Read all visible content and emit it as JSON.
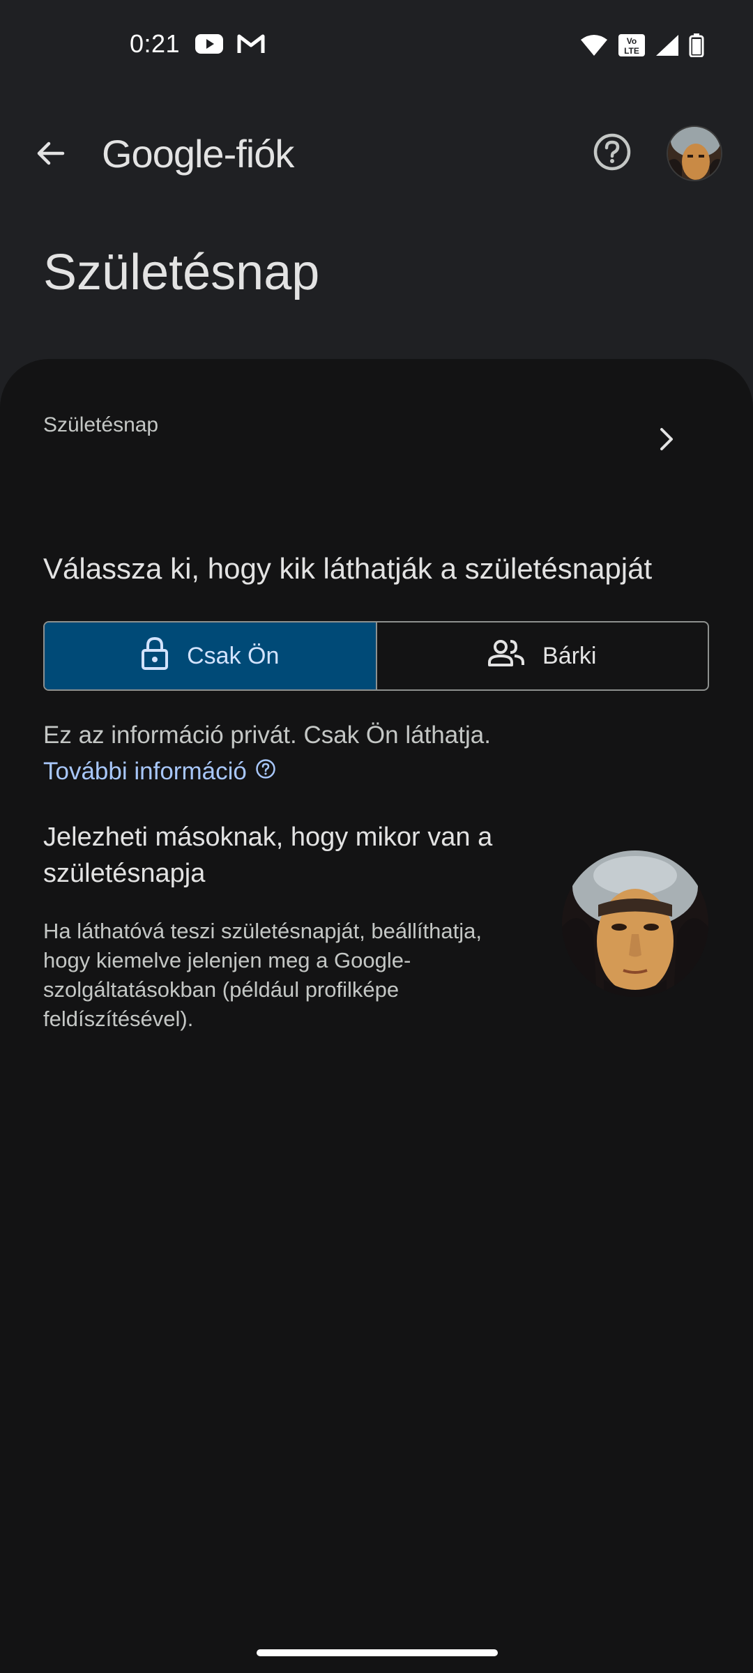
{
  "status_bar": {
    "time": "0:21",
    "left_icons": [
      "youtube-icon",
      "gmail-icon"
    ],
    "right_icons": [
      "wifi-icon",
      "volte-icon",
      "signal-icon",
      "battery-icon"
    ],
    "volte_text": "Vo LTE"
  },
  "app_bar": {
    "brand_google": "Google",
    "brand_suffix": "-fiók",
    "icons": [
      "back-arrow-icon",
      "help-icon",
      "avatar"
    ]
  },
  "page": {
    "title": "Születésnap"
  },
  "birthday_row": {
    "label": "Születésnap"
  },
  "visibility": {
    "heading": "Válassza ki, hogy kik láthatják a születésnapját",
    "options": [
      {
        "label": "Csak Ön",
        "icon": "lock-icon",
        "selected": true
      },
      {
        "label": "Bárki",
        "icon": "people-icon",
        "selected": false
      }
    ],
    "privacy_text": "Ez az információ privát. Csak Ön láthatja.",
    "more_info_link": "További információ"
  },
  "share": {
    "heading": "Jelezheti másoknak, hogy mikor van a születésnapja",
    "body": "Ha láthatóvá teszi születésnapját, beállíthatja, hogy kiemelve jelenjen meg a Google-szolgáltatásokban (például profilképe feldíszítésével)."
  },
  "colors": {
    "background": "#131314",
    "header_background": "#1f2023",
    "selected_segment": "#004a77",
    "link": "#a8c7fa"
  }
}
